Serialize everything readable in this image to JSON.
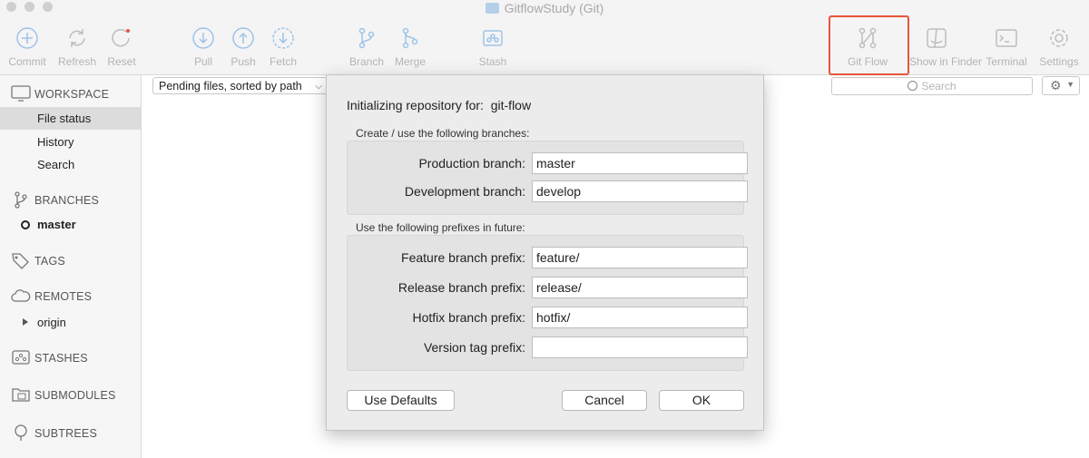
{
  "window": {
    "title": "GitflowStudy (Git)"
  },
  "toolbar": {
    "items": [
      {
        "label": "Commit",
        "icon": "commit-icon"
      },
      {
        "label": "Refresh",
        "icon": "refresh-icon"
      },
      {
        "label": "Reset",
        "icon": "reset-icon"
      },
      {
        "label": "Pull",
        "icon": "pull-icon"
      },
      {
        "label": "Push",
        "icon": "push-icon"
      },
      {
        "label": "Fetch",
        "icon": "fetch-icon"
      },
      {
        "label": "Branch",
        "icon": "branch-icon"
      },
      {
        "label": "Merge",
        "icon": "merge-icon"
      },
      {
        "label": "Stash",
        "icon": "stash-icon"
      },
      {
        "label": "Git Flow",
        "icon": "git-flow-icon"
      },
      {
        "label": "Show in Finder",
        "icon": "finder-icon"
      },
      {
        "label": "Terminal",
        "icon": "terminal-icon"
      },
      {
        "label": "Settings",
        "icon": "settings-icon"
      }
    ]
  },
  "sidebar": {
    "workspace": {
      "heading": "WORKSPACE",
      "items": [
        "File status",
        "History",
        "Search"
      ],
      "selected": "File status"
    },
    "branches": {
      "heading": "BRANCHES",
      "items": [
        "master"
      ]
    },
    "tags": {
      "heading": "TAGS"
    },
    "remotes": {
      "heading": "REMOTES",
      "items": [
        "origin"
      ]
    },
    "stashes": {
      "heading": "STASHES"
    },
    "submodules": {
      "heading": "SUBMODULES"
    },
    "subtrees": {
      "heading": "SUBTREES"
    }
  },
  "filter": {
    "selected": "Pending files, sorted by path"
  },
  "search": {
    "placeholder": "Search"
  },
  "dialog": {
    "title": "Initializing repository for:",
    "repo": "git-flow",
    "branches_caption": "Create / use the following branches:",
    "prefixes_caption": "Use the following prefixes in future:",
    "fields": {
      "production": {
        "label": "Production branch:",
        "value": "master"
      },
      "development": {
        "label": "Development branch:",
        "value": "develop"
      },
      "feature": {
        "label": "Feature branch prefix:",
        "value": "feature/"
      },
      "release": {
        "label": "Release branch prefix:",
        "value": "release/"
      },
      "hotfix": {
        "label": "Hotfix branch prefix:",
        "value": "hotfix/"
      },
      "version_tag": {
        "label": "Version tag prefix:",
        "value": ""
      }
    },
    "buttons": {
      "defaults": "Use Defaults",
      "cancel": "Cancel",
      "ok": "OK"
    }
  },
  "colors": {
    "accent_icon": "#9ec3e8",
    "highlight_box": "#e8553b",
    "selection": "#dcdcdc"
  }
}
